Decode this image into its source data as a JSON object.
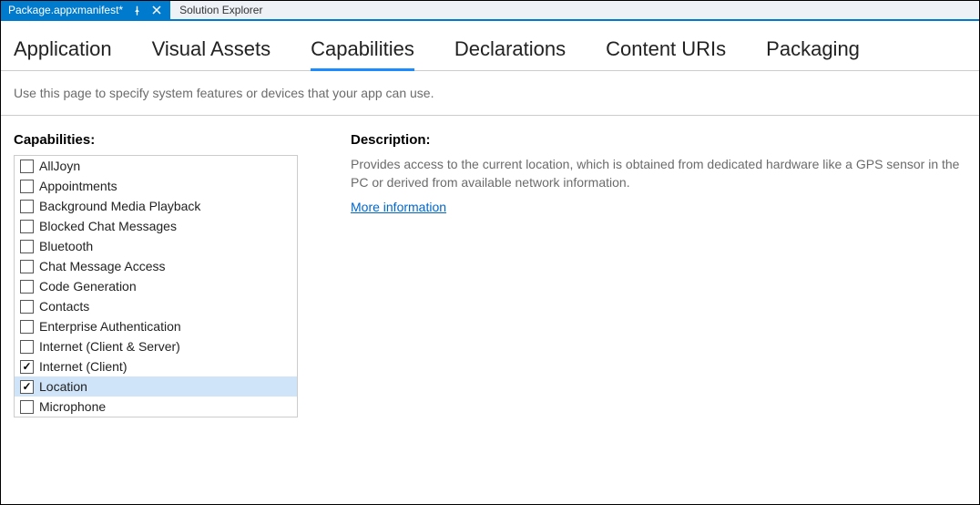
{
  "tabs": {
    "active_doc": "Package.appxmanifest*",
    "inactive_doc": "Solution Explorer"
  },
  "editor_tabs": [
    {
      "label": "Application",
      "active": false
    },
    {
      "label": "Visual Assets",
      "active": false
    },
    {
      "label": "Capabilities",
      "active": true
    },
    {
      "label": "Declarations",
      "active": false
    },
    {
      "label": "Content URIs",
      "active": false
    },
    {
      "label": "Packaging",
      "active": false
    }
  ],
  "page_description": "Use this page to specify system features or devices that your app can use.",
  "capabilities": {
    "header": "Capabilities:",
    "items": [
      {
        "label": "AllJoyn",
        "checked": false,
        "selected": false
      },
      {
        "label": "Appointments",
        "checked": false,
        "selected": false
      },
      {
        "label": "Background Media Playback",
        "checked": false,
        "selected": false
      },
      {
        "label": "Blocked Chat Messages",
        "checked": false,
        "selected": false
      },
      {
        "label": "Bluetooth",
        "checked": false,
        "selected": false
      },
      {
        "label": "Chat Message Access",
        "checked": false,
        "selected": false
      },
      {
        "label": "Code Generation",
        "checked": false,
        "selected": false
      },
      {
        "label": "Contacts",
        "checked": false,
        "selected": false
      },
      {
        "label": "Enterprise Authentication",
        "checked": false,
        "selected": false
      },
      {
        "label": "Internet (Client & Server)",
        "checked": false,
        "selected": false
      },
      {
        "label": "Internet (Client)",
        "checked": true,
        "selected": false
      },
      {
        "label": "Location",
        "checked": true,
        "selected": true
      },
      {
        "label": "Microphone",
        "checked": false,
        "selected": false
      }
    ]
  },
  "description": {
    "header": "Description:",
    "text": "Provides access to the current location, which is obtained from dedicated hardware like a GPS sensor in the PC or derived from available network information.",
    "link": "More information"
  }
}
